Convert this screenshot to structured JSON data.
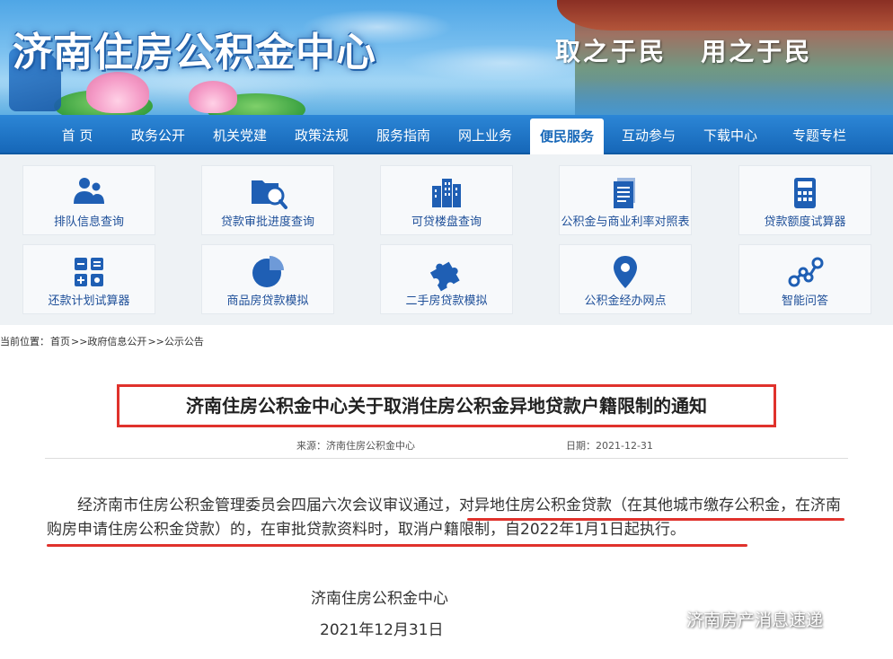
{
  "banner": {
    "site_title": "济南住房公积金中心",
    "slogan": "取之于民   用之于民"
  },
  "nav": {
    "items": [
      {
        "label": "首 页",
        "active": false
      },
      {
        "label": "政务公开",
        "active": false
      },
      {
        "label": "机关党建",
        "active": false
      },
      {
        "label": "政策法规",
        "active": false
      },
      {
        "label": "服务指南",
        "active": false
      },
      {
        "label": "网上业务",
        "active": false
      },
      {
        "label": "便民服务",
        "active": true
      },
      {
        "label": "互动参与",
        "active": false
      },
      {
        "label": "下载中心",
        "active": false
      },
      {
        "label": "专题专栏",
        "active": false
      }
    ]
  },
  "services": {
    "items": [
      {
        "label": "排队信息查询",
        "icon": "people-queue-icon"
      },
      {
        "label": "贷款审批进度查询",
        "icon": "folder-search-icon"
      },
      {
        "label": "可贷楼盘查询",
        "icon": "buildings-icon"
      },
      {
        "label": "公积金与商业利率对照表",
        "icon": "document-icon"
      },
      {
        "label": "贷款额度试算器",
        "icon": "calculator-icon"
      },
      {
        "label": "还款计划试算器",
        "icon": "calculator-grid-icon"
      },
      {
        "label": "商品房贷款模拟",
        "icon": "pie-chart-icon"
      },
      {
        "label": "二手房贷款模拟",
        "icon": "puzzle-icon"
      },
      {
        "label": "公积金经办网点",
        "icon": "map-pin-icon"
      },
      {
        "label": "智能问答",
        "icon": "network-nodes-icon"
      }
    ]
  },
  "breadcrumb": {
    "prefix": "当前位置：",
    "items": [
      "首页",
      ">>政府信息公开",
      ">>公示公告"
    ]
  },
  "article": {
    "title": "济南住房公积金中心关于取消住房公积金异地贷款户籍限制的通知",
    "source": "来源：济南住房公积金中心",
    "date": "日期：2021-12-31",
    "body_plain": "经济南市住房公积金管理委员会四届六次会议审议通过，",
    "body_highlight": "对异地住房公积金贷款（在其他城市缴存公积金，在济南购房申请住房公积金贷款）的，在审批贷款资料时，取消户籍限制，自2022年1月1日起执行。",
    "signature_org": "济南住房公积金中心",
    "signature_date": "2021年12月31日",
    "highlight_color": "#e0322c"
  },
  "watermark": {
    "text": "济南房产消息速递",
    "icon": "wechat-icon"
  },
  "colors": {
    "nav_blue": "#1667b8",
    "tile_text": "#1e4f99",
    "icon_blue": "#1f5fb4",
    "accent_red": "#e0322c"
  }
}
